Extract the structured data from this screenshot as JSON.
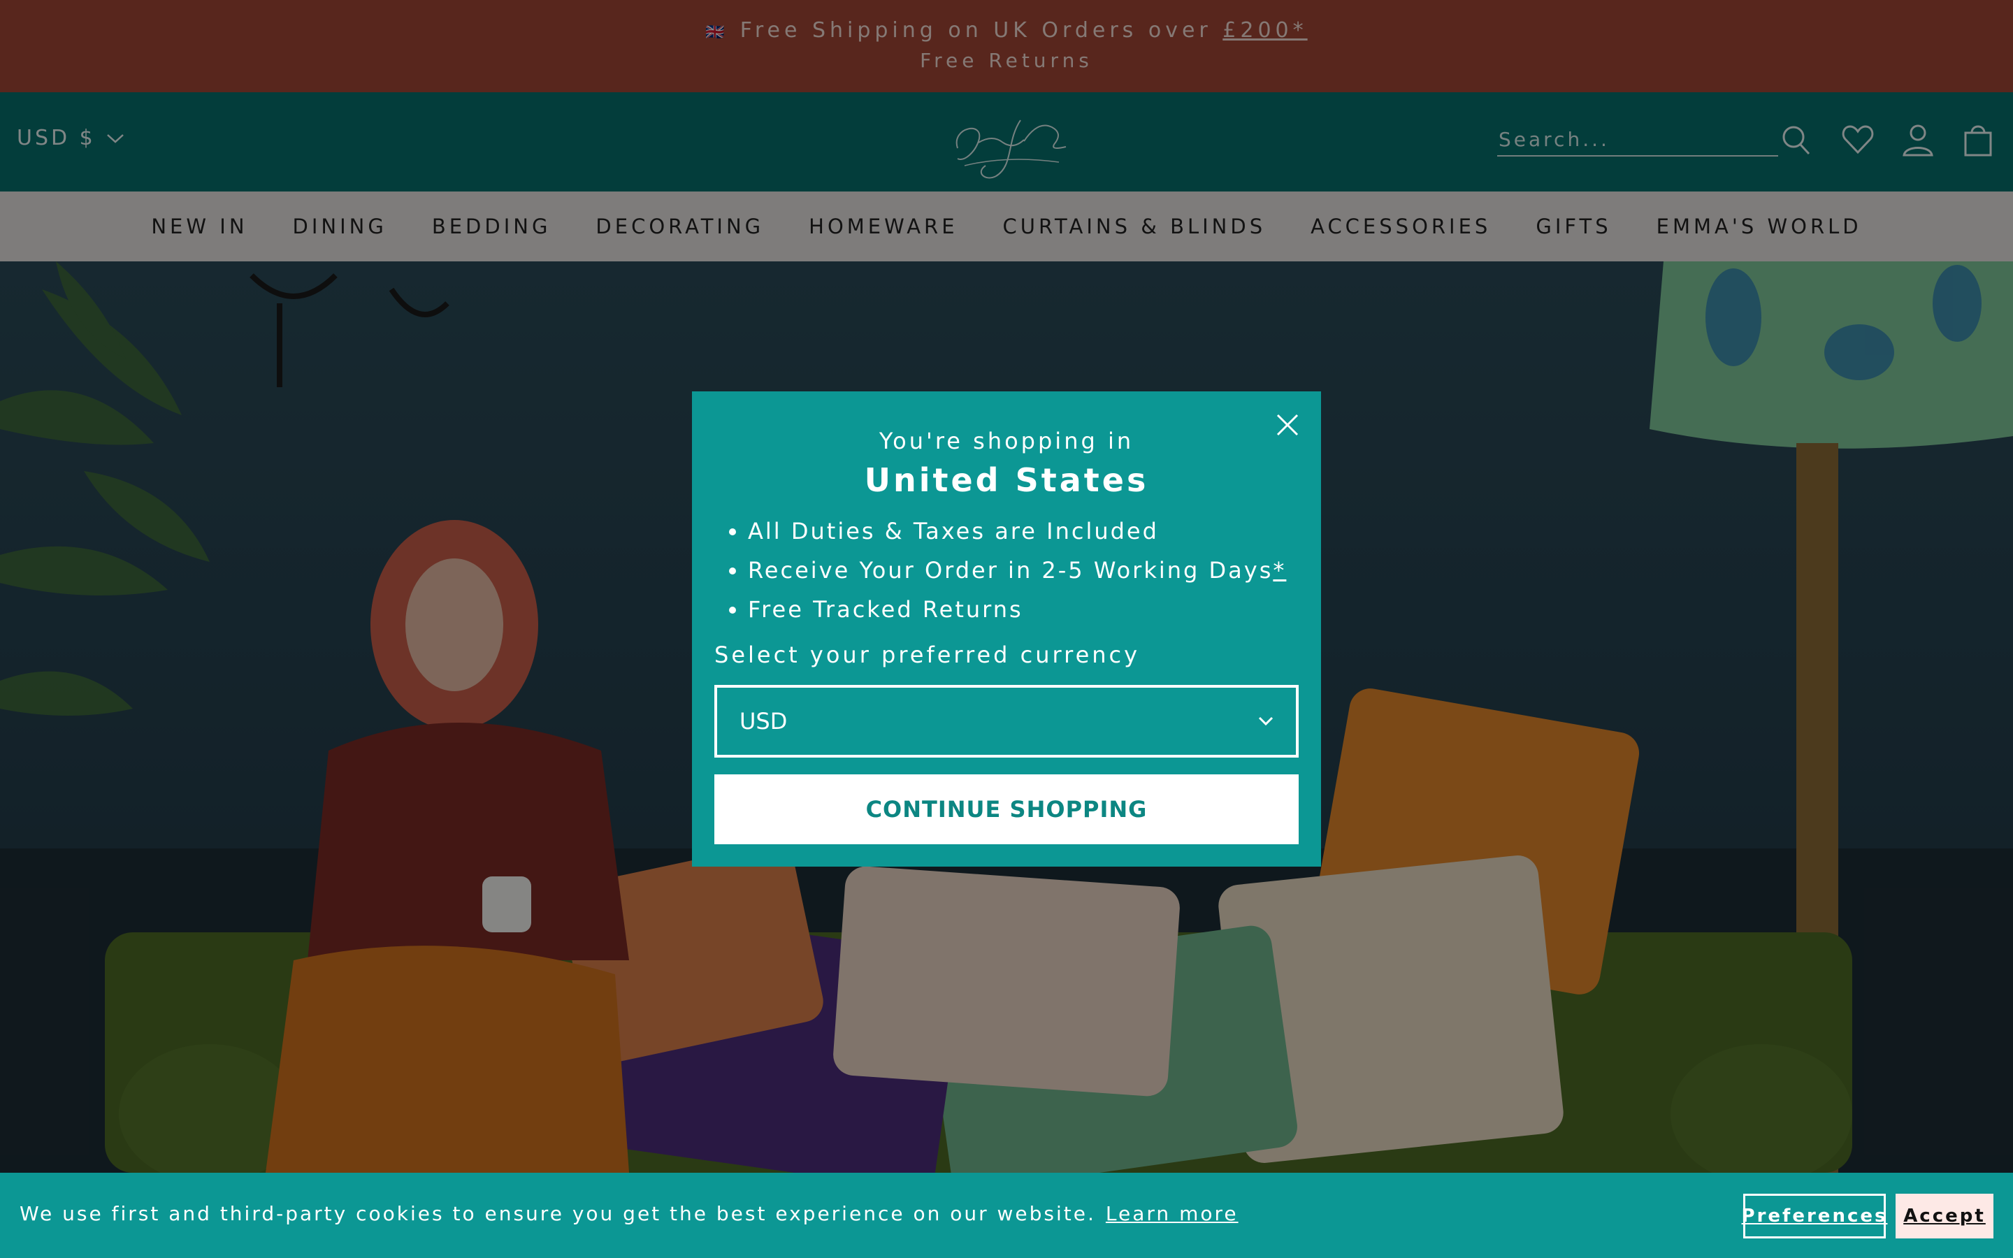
{
  "announcement": {
    "flag_icon": "uk-flag-icon",
    "shipping_text": "Free Shipping on UK Orders over ",
    "shipping_link": "£200*",
    "returns_text": "Free Returns"
  },
  "header": {
    "currency_label": "USD $",
    "logo_text": "Emma J Shipley",
    "search_placeholder": "Search...",
    "icons": [
      "search-icon",
      "heart-icon",
      "user-icon",
      "bag-icon"
    ]
  },
  "nav": {
    "items": [
      {
        "label": "NEW IN"
      },
      {
        "label": "DINING"
      },
      {
        "label": "BEDDING"
      },
      {
        "label": "DECORATING"
      },
      {
        "label": "HOMEWARE"
      },
      {
        "label": "CURTAINS & BLINDS"
      },
      {
        "label": "ACCESSORIES"
      },
      {
        "label": "GIFTS"
      },
      {
        "label": "EMMA'S WORLD"
      }
    ]
  },
  "modal": {
    "intro": "You're shopping in",
    "country": "United States",
    "benefits": [
      {
        "text": "All Duties & Taxes are Included",
        "suffix": ""
      },
      {
        "text": "Receive Your Order in 2-5 Working Days",
        "suffix": "*"
      },
      {
        "text": "Free Tracked Returns",
        "suffix": ""
      }
    ],
    "currency_prompt": "Select your preferred currency",
    "currency_selected": "USD",
    "cta": "CONTINUE SHOPPING"
  },
  "cookie": {
    "message": "We use first and third-party cookies to ensure you get the best experience on our website.",
    "learn_more": "Learn more",
    "preferences": "Preferences",
    "accept": "Accept"
  },
  "colors": {
    "announcement_bg": "#a04535",
    "header_bg": "#066f6c",
    "nav_bg": "#e6e2e1",
    "modal_bg": "#0c9794",
    "cookie_bg": "#0c9794",
    "accept_bg": "#fde9e6"
  }
}
